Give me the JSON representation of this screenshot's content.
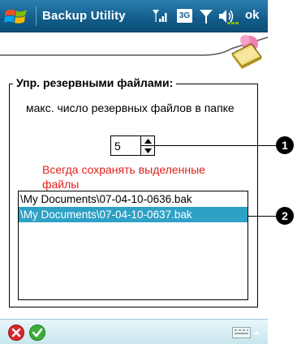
{
  "titlebar": {
    "title": "Backup Utility",
    "ok_label": "ok",
    "icons": [
      "windows-start-icon",
      "signal-icon",
      "3g-icon",
      "antenna-icon",
      "volume-icon"
    ],
    "network_badge": "3G"
  },
  "group": {
    "title": "Упр. резервными файлами:",
    "description": "макс. число резервных файлов в папке",
    "max_files_value": "5",
    "warning": "Всегда сохранять выделенные файлы"
  },
  "backup_files": [
    {
      "name": "\\My Documents\\07-04-10-0636.bak",
      "selected": false
    },
    {
      "name": "\\My Documents\\07-04-10-0637.bak",
      "selected": true
    }
  ],
  "callouts": [
    "1",
    "2"
  ],
  "bottombar": {
    "icons": [
      "cancel-icon",
      "confirm-icon",
      "keyboard-icon"
    ]
  },
  "colors": {
    "titlebar": "#125c8a",
    "selection": "#2ea1c6",
    "warning_text": "#e0201c",
    "bottombar": "#c8e6ee"
  }
}
